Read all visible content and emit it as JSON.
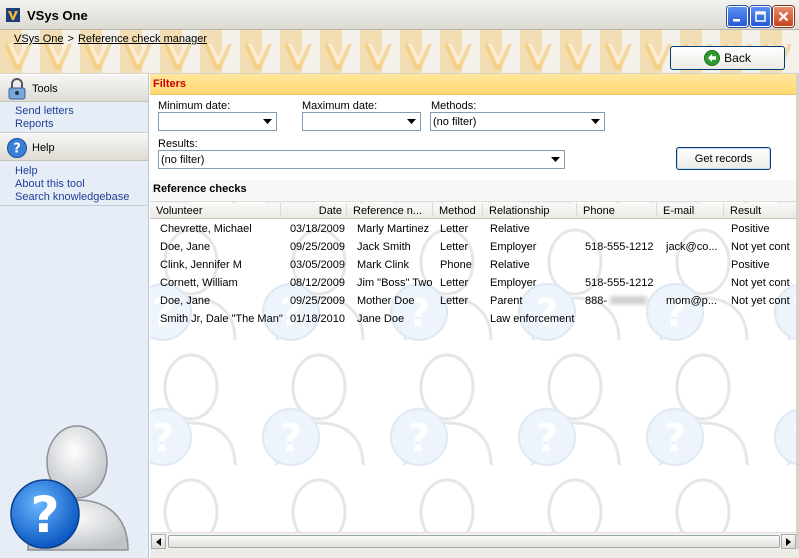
{
  "window": {
    "title": "VSys One",
    "controls": [
      "minimize-icon",
      "maximize-icon",
      "close-icon"
    ]
  },
  "breadcrumb": {
    "root": "VSys One",
    "separator": ">",
    "current": "Reference check manager"
  },
  "toolbar": {
    "back_label": "Back"
  },
  "sidebar": {
    "tools": {
      "title": "Tools",
      "items": [
        {
          "label": "Send letters"
        },
        {
          "label": "Reports"
        }
      ]
    },
    "help": {
      "title": "Help",
      "items": [
        {
          "label": "Help"
        },
        {
          "label": "About this tool"
        },
        {
          "label": "Search knowledgebase"
        }
      ]
    }
  },
  "filters": {
    "title": "Filters",
    "min_date_label": "Minimum date:",
    "min_date_value": "",
    "max_date_label": "Maximum date:",
    "max_date_value": "",
    "methods_label": "Methods:",
    "methods_value": "(no filter)",
    "results_label": "Results:",
    "results_value": "(no filter)",
    "get_records_label": "Get records"
  },
  "reference_checks": {
    "title": "Reference checks",
    "columns": [
      "Volunteer",
      "Date",
      "Reference n...",
      "Method",
      "Relationship",
      "Phone",
      "E-mail",
      "Result"
    ],
    "rows": [
      [
        "Chevrette, Michael",
        "03/18/2009",
        "Marly Martinez",
        "Letter",
        "Relative",
        "",
        "",
        "Positive"
      ],
      [
        "Doe, Jane",
        "09/25/2009",
        "Jack Smith",
        "Letter",
        "Employer",
        "518-555-1212",
        "jack@co...",
        "Not yet cont"
      ],
      [
        "Clink, Jennifer M",
        "03/05/2009",
        "Mark Clink",
        "Phone",
        "Relative",
        "",
        "",
        "Positive"
      ],
      [
        "Cornett, William",
        "08/12/2009",
        "Jim \"Boss\" Two",
        "Letter",
        "Employer",
        "518-555-1212",
        "",
        "Not yet cont"
      ],
      [
        "Doe, Jane",
        "09/25/2009",
        "Mother Doe",
        "Letter",
        "Parent",
        "888-",
        "mom@p...",
        "Not yet cont"
      ],
      [
        "Smith Jr, Dale \"The Man\"",
        "01/18/2010",
        "Jane Doe",
        "",
        "Law enforcement",
        "",
        "",
        ""
      ]
    ]
  },
  "colors": {
    "filters_bar": "#ffd873",
    "filters_title": "#cc0000",
    "sidebar_bg": "#e6edf7",
    "link": "#1e3f96",
    "window_button": "#2559d6",
    "close_button": "#c8411f"
  }
}
